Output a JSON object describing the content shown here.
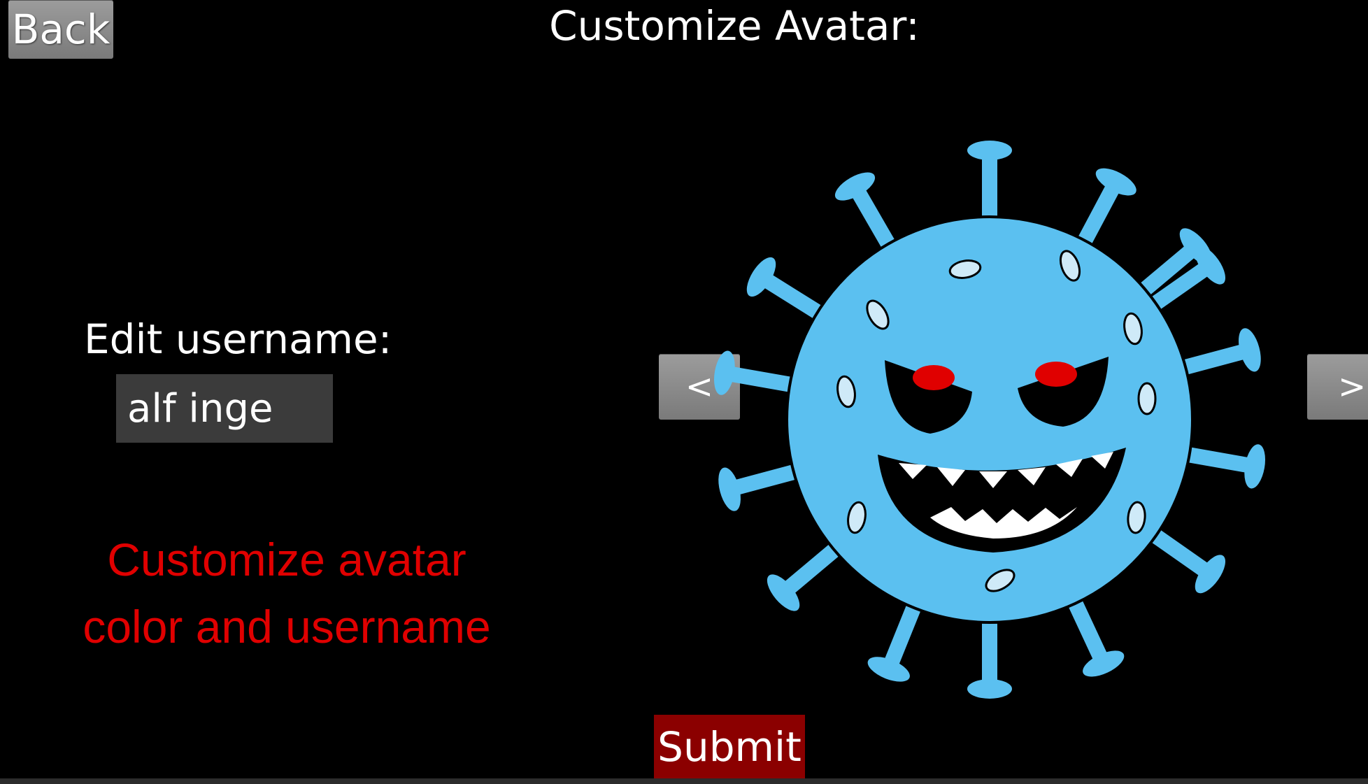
{
  "header": {
    "back_label": "Back",
    "title": "Customize Avatar:"
  },
  "form": {
    "username_label": "Edit username:",
    "username_value": "alf inge"
  },
  "caption": {
    "line1": "Customize avatar",
    "line2": "color and username"
  },
  "avatar_picker": {
    "prev_label": "<",
    "next_label": ">",
    "avatar_icon": "virus-monster-icon",
    "avatar_color": "#5bc0f0",
    "eye_color": "#e00000"
  },
  "footer": {
    "submit_label": "Submit"
  },
  "colors": {
    "background": "#000000",
    "button_gray": "#8a8a8a",
    "submit_red": "#8b0000",
    "caption_red": "#e00000"
  }
}
